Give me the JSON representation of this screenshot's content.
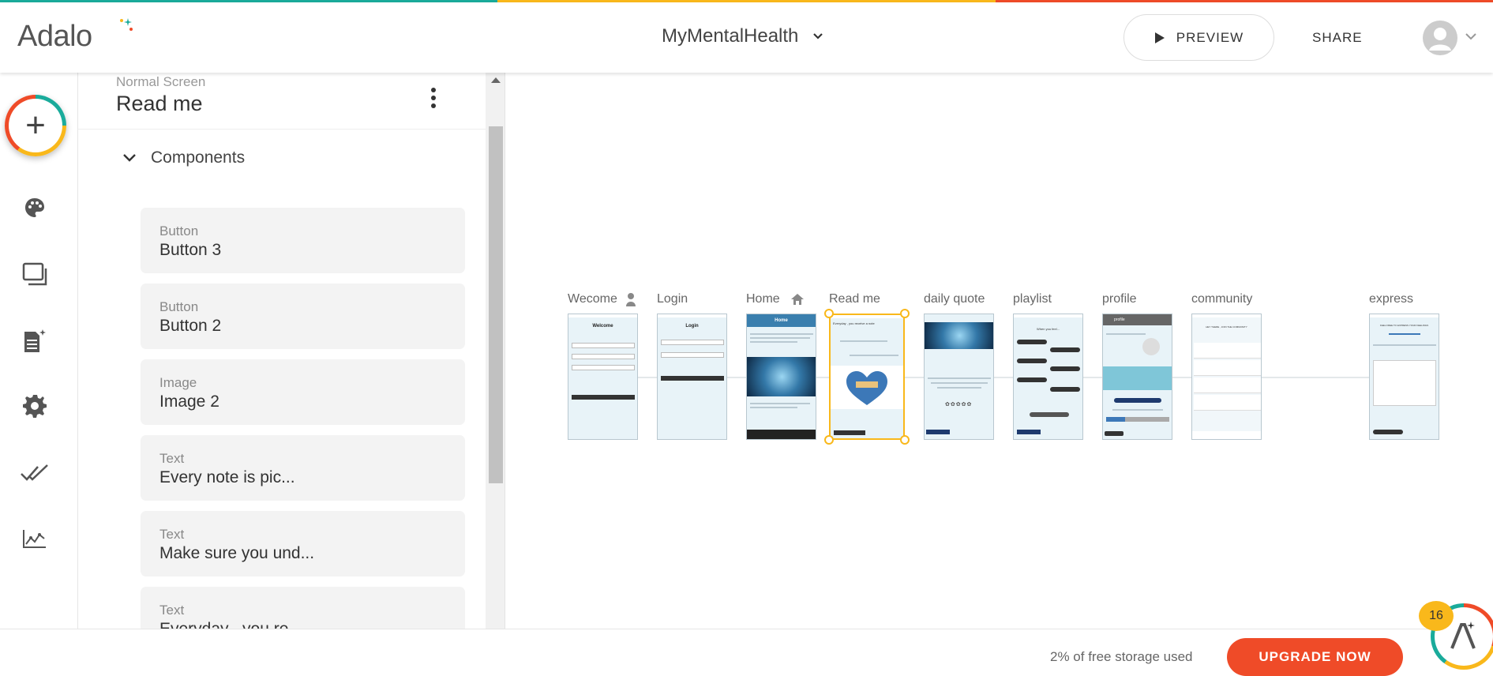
{
  "header": {
    "logo_text": "Adalo",
    "app_name": "MyMentalHealth",
    "preview_label": "PREVIEW",
    "share_label": "SHARE"
  },
  "rail": {
    "icons": [
      "plus-icon",
      "palette-icon",
      "screens-icon",
      "database-icon",
      "gear-icon",
      "publish-check-icon",
      "analytics-icon"
    ]
  },
  "panel": {
    "screen_type": "Normal Screen",
    "screen_name": "Read me",
    "components_label": "Components",
    "components": [
      {
        "type": "Button",
        "name": "Button 3"
      },
      {
        "type": "Button",
        "name": "Button 2"
      },
      {
        "type": "Image",
        "name": "Image 2"
      },
      {
        "type": "Text",
        "name": "Every note is pic..."
      },
      {
        "type": "Text",
        "name": "Make sure you und..."
      },
      {
        "type": "Text",
        "name": "Everyday , you re..."
      }
    ]
  },
  "canvas": {
    "screens": [
      {
        "label": "Wecome",
        "title": "Welcome"
      },
      {
        "label": "Login",
        "title": "Login"
      },
      {
        "label": "Home",
        "title": "Home"
      },
      {
        "label": "Read me",
        "title": "Everyday , you receive a note"
      },
      {
        "label": "daily quote",
        "title": ""
      },
      {
        "label": "playlist",
        "title": "When you feel..."
      },
      {
        "label": "profile",
        "title": "profile"
      },
      {
        "label": "community",
        "title": "HEY THERE , JOIN THE COMMUNITY"
      },
      {
        "label": "express",
        "title": "FEEL FREE TO EXPRESS YOUR FEELINGS"
      }
    ]
  },
  "footer": {
    "storage_text": "2% of free storage used",
    "upgrade_label": "UPGRADE NOW",
    "notification_count": "16"
  },
  "colors": {
    "brand_teal": "#1aab9b",
    "brand_yellow": "#f9b81b",
    "brand_red": "#ef4b28",
    "selection": "#f9b81b"
  }
}
